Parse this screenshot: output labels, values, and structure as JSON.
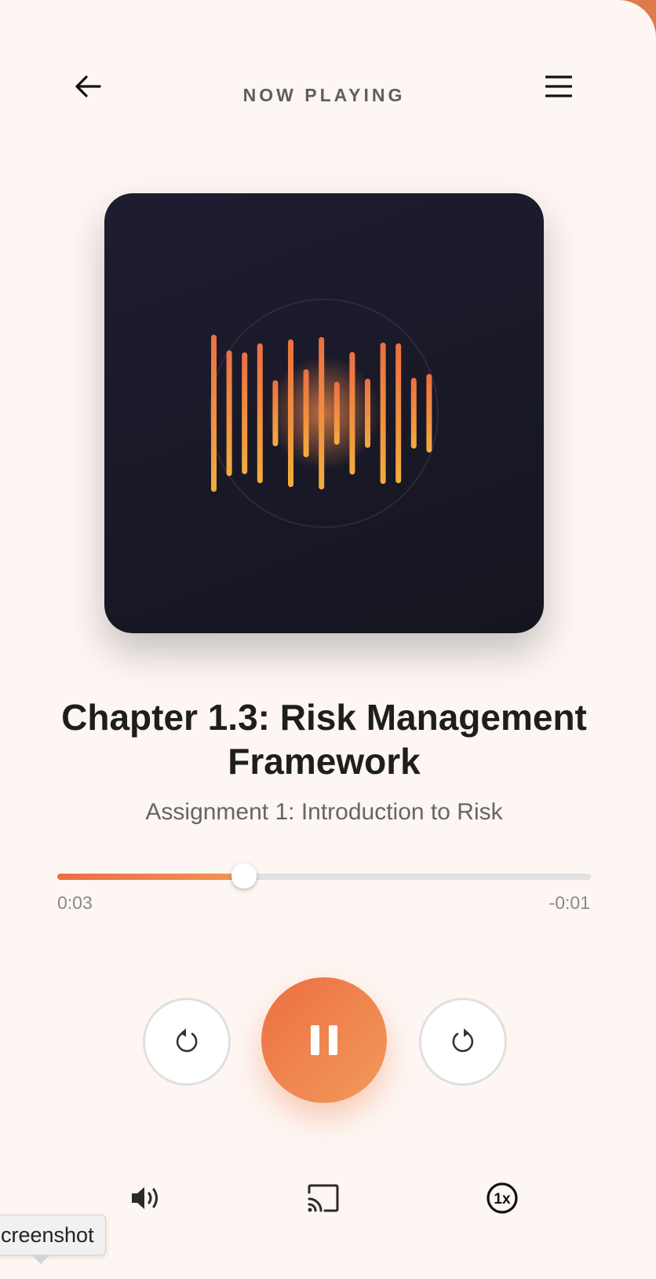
{
  "header": {
    "title": "NOW PLAYING",
    "back_icon": "arrow-left-icon",
    "menu_icon": "hamburger-menu-icon"
  },
  "artwork": {
    "icon": "audio-waveform-art",
    "accent": "#ef7f45",
    "background": "#1b1a2a"
  },
  "track": {
    "title": "Chapter 1.3: Risk Management Framework",
    "subtitle": "Assignment 1: Introduction to Risk"
  },
  "progress": {
    "elapsed": "0:03",
    "remaining": "-0:01",
    "fraction": 0.35
  },
  "controls": {
    "rewind_icon": "rewind-icon",
    "play_pause_icon": "pause-icon",
    "forward_icon": "forward-icon"
  },
  "bottom_bar": {
    "volume_icon": "volume-icon",
    "cast_icon": "cast-icon",
    "speed_icon": "playback-speed-icon",
    "speed_label": "1x"
  },
  "tooltip": {
    "text": "creenshot"
  },
  "colors": {
    "accent": "#ee7a45",
    "background": "#fdf6f2",
    "frame": "#e07a4a"
  }
}
